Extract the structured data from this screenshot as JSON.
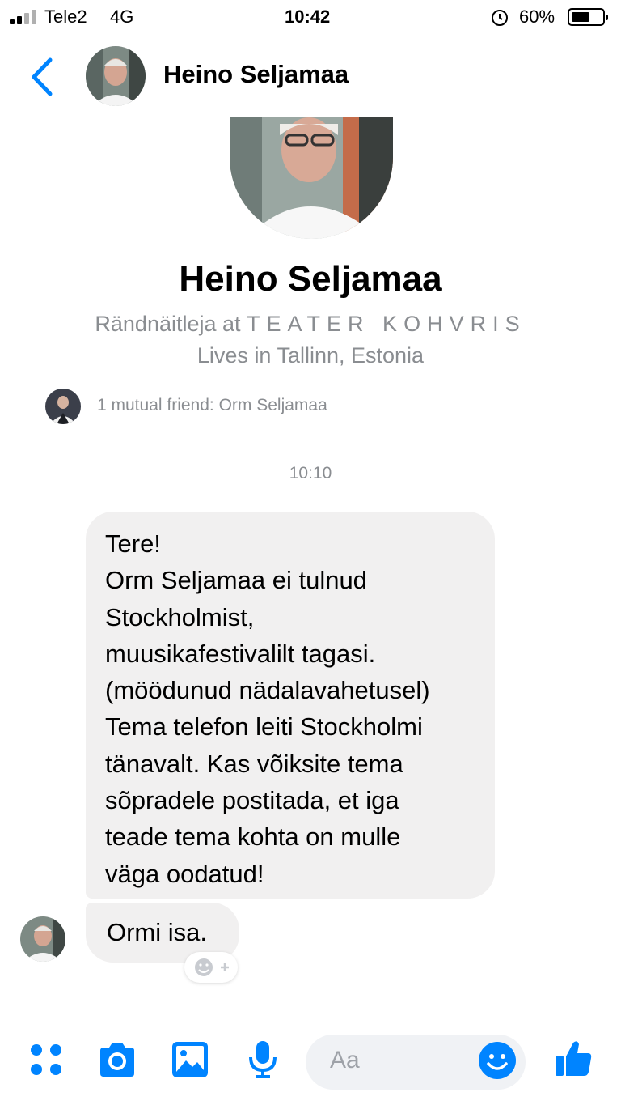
{
  "status_bar": {
    "carrier": "Tele2",
    "network": "4G",
    "time": "10:42",
    "battery_percent": "60%",
    "battery_level": 0.6
  },
  "header": {
    "contact_name": "Heino Seljamaa"
  },
  "profile": {
    "name": "Heino Seljamaa",
    "job_prefix": "Rändnäitleja at",
    "job_org": "TEATER KOHVRIS",
    "location": "Lives in Tallinn, Estonia",
    "mutual_friends": "1 mutual friend: Orm Seljamaa"
  },
  "conversation": {
    "timestamp": "10:10",
    "message1_lines": [
      "Tere!",
      "Orm Seljamaa ei tulnud",
      "Stockholmist,",
      "muusikafestivalilt tagasi.",
      "(möödunud nädalavahetusel)",
      "Tema telefon leiti Stockholmi",
      "tänavalt. Kas võiksite tema",
      "sõpradele postitada, et iga",
      "teade tema kohta on mulle",
      "väga oodatud!"
    ],
    "message2": "Ormi isa."
  },
  "composer": {
    "placeholder": "Aa"
  },
  "colors": {
    "accent": "#0084ff",
    "bubble": "#f1f0f0",
    "secondary_text": "#8a8d91"
  },
  "icons": [
    "signal-icon",
    "alarm-lock-icon",
    "battery-icon",
    "back-chevron-icon",
    "react-emoji-icon",
    "menu-dots-icon",
    "camera-icon",
    "photo-icon",
    "microphone-icon",
    "emoji-icon",
    "thumbs-up-icon"
  ]
}
